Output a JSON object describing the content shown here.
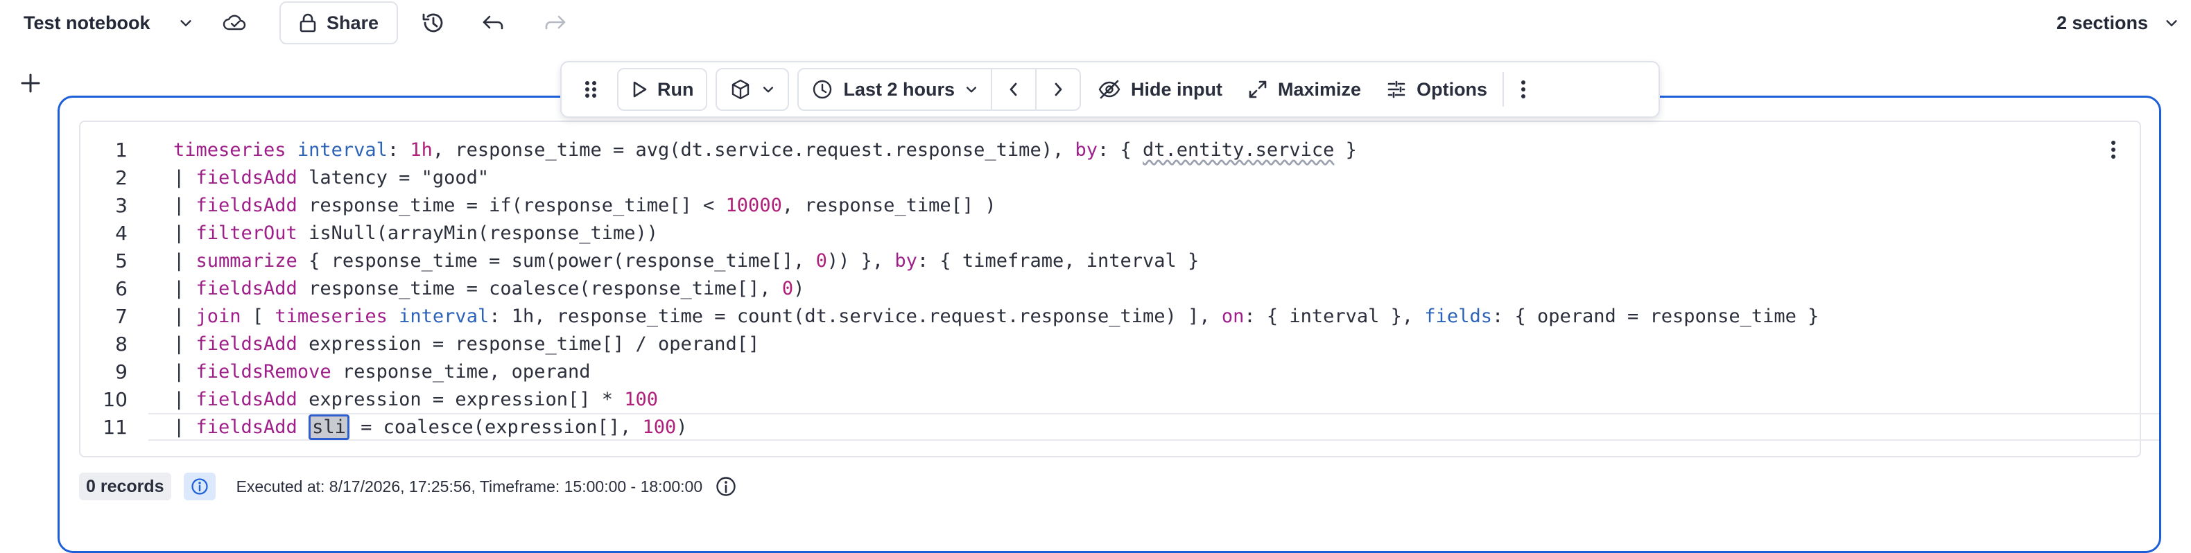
{
  "header": {
    "title": "Test notebook",
    "share_label": "Share",
    "sections_label": "2 sections"
  },
  "toolbar": {
    "run_label": "Run",
    "timeframe_label": "Last 2 hours",
    "hide_input_label": "Hide input",
    "maximize_label": "Maximize",
    "options_label": "Options"
  },
  "editor": {
    "line_numbers": [
      "1",
      "2",
      "3",
      "4",
      "5",
      "6",
      "7",
      "8",
      "9",
      "10",
      "11"
    ],
    "lines": [
      "timeseries interval: 1h, response_time = avg(dt.service.request.response_time), by: { dt.entity.service }",
      "| fieldsAdd latency = \"good\"",
      "| fieldsAdd response_time = if(response_time[] < 10000, response_time[] )",
      "| filterOut isNull(arrayMin(response_time))",
      "| summarize { response_time = sum(power(response_time[], 0)) }, by: { timeframe, interval }",
      "| fieldsAdd response_time = coalesce(response_time[], 0)",
      "| join [ timeseries interval: 1h, response_time = count(dt.service.request.response_time) ], on: { interval }, fields: { operand = response_time }",
      "| fieldsAdd expression = response_time[] / operand[]",
      "| fieldsRemove response_time, operand",
      "| fieldsAdd expression = expression[] * 100",
      "| fieldsAdd sli = coalesce(expression[], 100)"
    ]
  },
  "status": {
    "records": "0 records",
    "executed": "Executed at: 8/17/2026, 17:25:56, Timeframe: 15:00:00 - 18:00:00"
  },
  "icons": [
    "chevron-down-icon",
    "cloud-sync-icon",
    "lock-icon",
    "history-icon",
    "undo-icon",
    "redo-icon",
    "plus-icon",
    "drag-handle-icon",
    "play-icon",
    "cube-icon",
    "clock-icon",
    "chevron-left-icon",
    "chevron-right-icon",
    "eye-off-icon",
    "maximize-icon",
    "sliders-icon",
    "more-vertical-icon",
    "info-icon"
  ],
  "colors": {
    "accent": "#1c5fd8",
    "keyword": "#9e1f8a",
    "function": "#2c63b7",
    "number": "#b0207a"
  }
}
